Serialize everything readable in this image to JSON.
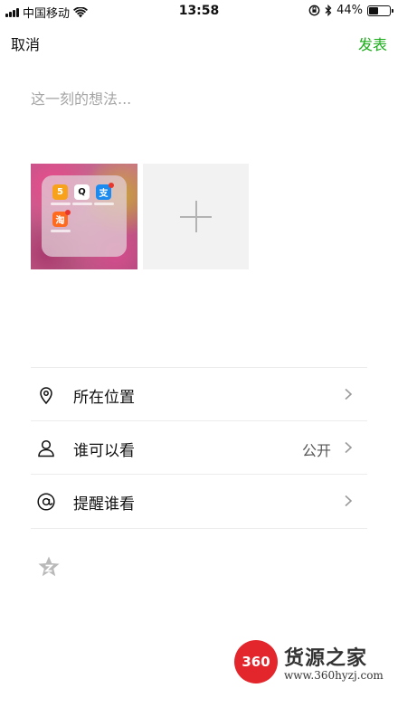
{
  "status_bar": {
    "carrier": "中国移动",
    "time": "13:58",
    "battery": "44%",
    "battery_level": 0.44,
    "icons": [
      "signal-icon",
      "wifi-icon",
      "orientation-lock-icon",
      "bluetooth-icon",
      "battery-icon"
    ]
  },
  "nav": {
    "cancel_label": "取消",
    "publish_label": "发表"
  },
  "composer": {
    "placeholder": "这一刻的想法...",
    "value": ""
  },
  "photos": {
    "add_icon": "plus-icon",
    "thumbnail_apps": [
      {
        "glyph": "5"
      },
      {
        "glyph": "Q"
      },
      {
        "glyph": "支"
      },
      {
        "glyph": "淘"
      }
    ]
  },
  "options": [
    {
      "label": "所在位置",
      "value": "",
      "icon": "location-pin-icon"
    },
    {
      "label": "谁可以看",
      "value": "公开",
      "icon": "person-icon"
    },
    {
      "label": "提醒谁看",
      "value": "",
      "icon": "at-icon"
    }
  ],
  "colors": {
    "accent": "#1aad19",
    "divider": "#ececec",
    "placeholder": "#a5a5a5"
  },
  "watermark": {
    "logo_text": "360",
    "brand": "货源之家",
    "url": "www.360hyzj.com"
  }
}
